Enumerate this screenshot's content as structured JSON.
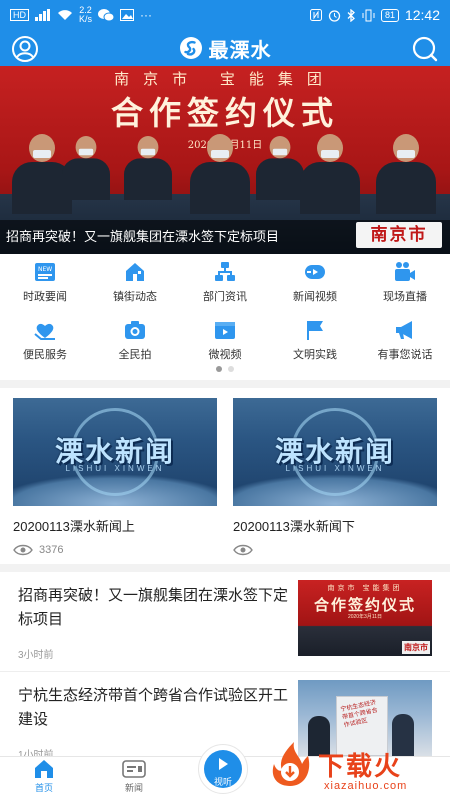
{
  "status_bar": {
    "signal": "HD",
    "speed_top": "2.2",
    "speed_bottom": "K/s",
    "battery": "81",
    "time": "12:42"
  },
  "header": {
    "title": "最溧水"
  },
  "banner": {
    "sign_org": "南京市 宝能集团",
    "sign_main": "合作签约仪式",
    "sign_date": "2020年3月11日",
    "caption": "招商再突破！又一旗舰集团在溧水签下定标项目",
    "tv_logo": "南京市"
  },
  "grid": [
    {
      "label": "时政要闻",
      "icon": "news-icon"
    },
    {
      "label": "镇街动态",
      "icon": "town-icon"
    },
    {
      "label": "部门资讯",
      "icon": "department-icon"
    },
    {
      "label": "新闻视频",
      "icon": "video-icon"
    },
    {
      "label": "现场直播",
      "icon": "live-camera-icon"
    },
    {
      "label": "便民服务",
      "icon": "service-icon"
    },
    {
      "label": "全民拍",
      "icon": "camera-icon"
    },
    {
      "label": "微视频",
      "icon": "micro-video-icon"
    },
    {
      "label": "文明实践",
      "icon": "flag-icon"
    },
    {
      "label": "有事您说话",
      "icon": "megaphone-icon"
    }
  ],
  "videos": [
    {
      "title": "20200113溧水新闻上",
      "views": "3376",
      "logo": "溧水新闻",
      "pinyin": "LISHUI XINWEN"
    },
    {
      "title": "20200113溧水新闻下",
      "views": "",
      "logo": "溧水新闻",
      "pinyin": "LISHUI XINWEN"
    }
  ],
  "news": [
    {
      "title": "招商再突破！又一旗舰集团在溧水签下定标项目",
      "time": "3小时前",
      "thumb_org": "南京市 宝能集团",
      "thumb_main": "合作签约仪式",
      "thumb_date": "2020年3月11日",
      "thumb_logo": "南京市"
    },
    {
      "title": "宁杭生态经济带首个跨省合作试验区开工建设",
      "time": "1小时前",
      "thumb_text": "宁杭生态经济带首个跨省合作试验区"
    }
  ],
  "tabs": {
    "home": "首页",
    "news": "新闻",
    "video": "视听"
  },
  "watermark": {
    "title": "下载火",
    "url": "xiazaihuo.com"
  },
  "colors": {
    "primary": "#1f8ee8",
    "watermark": "#e8421a"
  }
}
